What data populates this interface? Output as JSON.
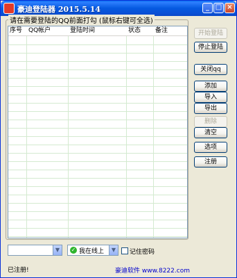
{
  "window": {
    "title": "豪迪登陆器 2015.5.14",
    "controls": [
      "_",
      "□",
      "×"
    ]
  },
  "group_label": "请在需要登陆的QQ前面打勾 (鼠标右键可全选)",
  "table": {
    "columns": [
      "序号",
      "QQ帐户",
      "登陆时间",
      "状态",
      "备注"
    ],
    "rows": []
  },
  "buttons": {
    "start_login": "开始登陆",
    "stop_login": "停止登陆",
    "close_qq": "关闭qq",
    "add": "添加",
    "import": "导入",
    "export": "导出",
    "delete": "删除",
    "clear": "清空",
    "options": "选项",
    "register": "注册"
  },
  "bottom": {
    "account_combo_value": "",
    "online_status_value": "我在线上",
    "remember_password": "记住密码",
    "remember_checked": false
  },
  "status": {
    "registered": "已注册!",
    "website": "豪迪软件 www.8222.com"
  },
  "icons": {
    "app": "app-icon",
    "online": "online-status-icon",
    "dropdown": "chevron-down-icon"
  }
}
